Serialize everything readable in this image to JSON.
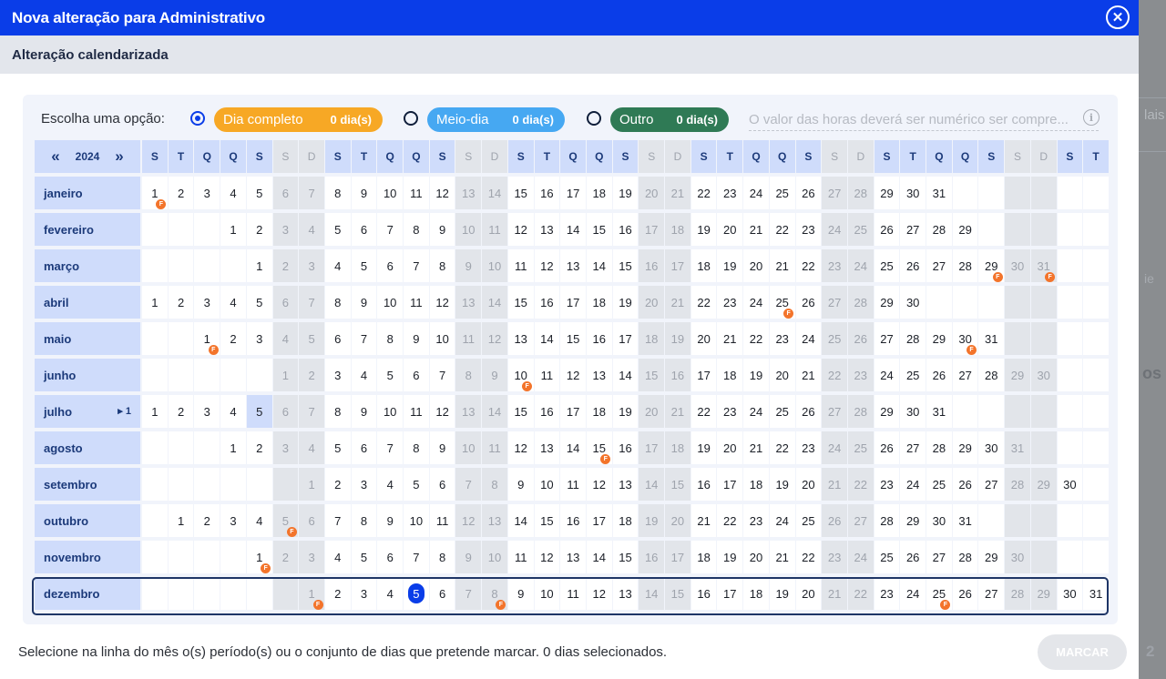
{
  "window": {
    "title": "Nova alteração para Administrativo",
    "close_icon": "close-icon"
  },
  "subheader": {
    "title": "Alteração calendarizada"
  },
  "options": {
    "label": "Escolha uma opção:",
    "items": [
      {
        "label": "Dia completo",
        "count": "0 dia(s)",
        "selected": true,
        "color": "#f7a825"
      },
      {
        "label": "Meio-dia",
        "count": "0 dia(s)",
        "selected": false,
        "color": "#46a8f2"
      },
      {
        "label": "Outro",
        "count": "0 dia(s)",
        "selected": false,
        "color": "#2f7a55"
      }
    ],
    "hours_placeholder": "O valor das horas deverá ser numérico ser compre..."
  },
  "calendar": {
    "year": "2024",
    "weekday_headers": [
      "S",
      "T",
      "Q",
      "Q",
      "S",
      "S",
      "D",
      "S",
      "T",
      "Q",
      "Q",
      "S",
      "S",
      "D",
      "S",
      "T",
      "Q",
      "Q",
      "S",
      "S",
      "D",
      "S",
      "T",
      "Q",
      "Q",
      "S",
      "S",
      "D",
      "S",
      "T",
      "Q",
      "Q",
      "S",
      "S",
      "D",
      "S",
      "T"
    ],
    "months": [
      {
        "name": "janeiro",
        "days": 31
      },
      {
        "name": "fevereiro",
        "days": 29
      },
      {
        "name": "março",
        "days": 31
      },
      {
        "name": "abril",
        "days": 30
      },
      {
        "name": "maio",
        "days": 31
      },
      {
        "name": "junho",
        "days": 30
      },
      {
        "name": "julho",
        "days": 31,
        "marker": "1"
      },
      {
        "name": "agosto",
        "days": 31
      },
      {
        "name": "setembro",
        "days": 30
      },
      {
        "name": "outubro",
        "days": 31
      },
      {
        "name": "novembro",
        "days": 30
      },
      {
        "name": "dezembro",
        "days": 31
      }
    ],
    "holidays": [
      [
        "janeiro",
        1
      ],
      [
        "março",
        29
      ],
      [
        "março",
        31
      ],
      [
        "abril",
        25
      ],
      [
        "maio",
        1
      ],
      [
        "maio",
        30
      ],
      [
        "junho",
        10
      ],
      [
        "agosto",
        15
      ],
      [
        "outubro",
        5
      ],
      [
        "novembro",
        1
      ],
      [
        "dezembro",
        1
      ],
      [
        "dezembro",
        8
      ],
      [
        "dezembro",
        25
      ]
    ],
    "holiday_badge": "F",
    "today": [
      "dezembro",
      5
    ],
    "highlighted_day": [
      "julho",
      5
    ],
    "current_month": "dezembro"
  },
  "footer": {
    "hint": "Selecione na linha do mês o(s) período(s) ou o conjunto de dias que pretende marcar. 0 dias selecionados.",
    "button_label": "MARCAR",
    "page_number": "2"
  },
  "background": {
    "fragment_text": "lais",
    "fragment_text2": "os",
    "fragment_text3": "ie"
  }
}
